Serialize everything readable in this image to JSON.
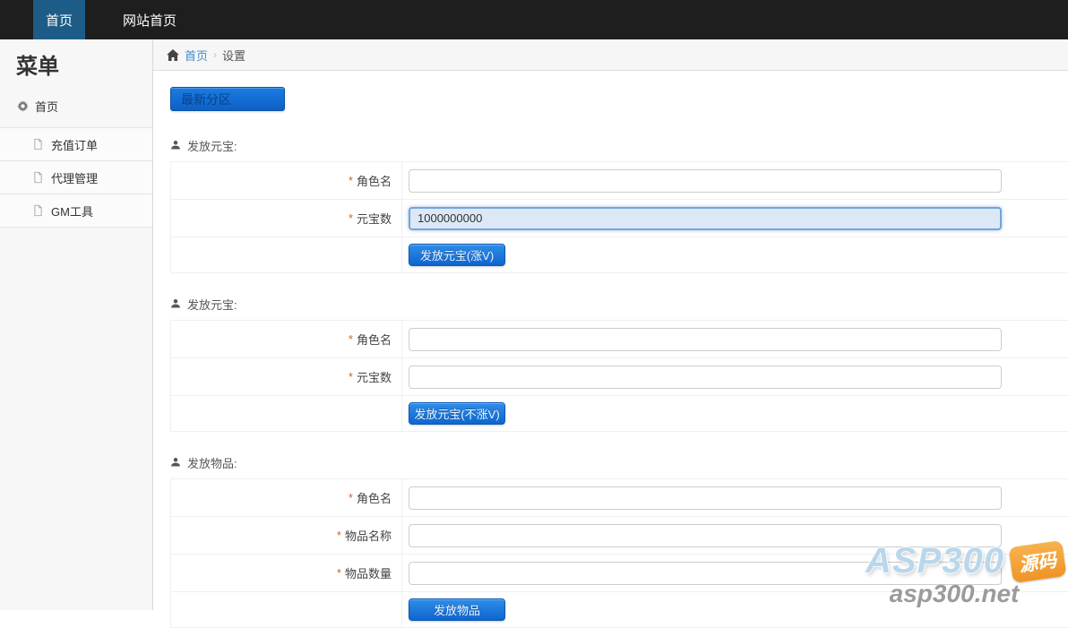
{
  "topbar": {
    "tabs": [
      {
        "label": "首页",
        "active": true
      },
      {
        "label": "网站首页",
        "active": false
      }
    ]
  },
  "sidebar": {
    "title": "菜单",
    "home": {
      "label": "首页"
    },
    "items": [
      {
        "label": "充值订单"
      },
      {
        "label": "代理管理"
      },
      {
        "label": "GM工具"
      }
    ]
  },
  "breadcrumb": {
    "home_label": "首页",
    "separator": "›",
    "current": "设置"
  },
  "content": {
    "zone_button": {
      "label": "最新分区"
    },
    "required_marker": "*",
    "sections": [
      {
        "title": "发放元宝:",
        "fields": [
          {
            "label": "角色名",
            "required": true,
            "value": "",
            "focused": false
          },
          {
            "label": "元宝数",
            "required": true,
            "value": "1000000000",
            "focused": true
          }
        ],
        "submit_label": "发放元宝(涨V)"
      },
      {
        "title": "发放元宝:",
        "fields": [
          {
            "label": "角色名",
            "required": true,
            "value": "",
            "focused": false
          },
          {
            "label": "元宝数",
            "required": true,
            "value": "",
            "focused": false
          }
        ],
        "submit_label": "发放元宝(不涨V)"
      },
      {
        "title": "发放物品:",
        "fields": [
          {
            "label": "角色名",
            "required": true,
            "value": "",
            "focused": false
          },
          {
            "label": "物品名称",
            "required": true,
            "value": "",
            "focused": false
          },
          {
            "label": "物品数量",
            "required": true,
            "value": "",
            "focused": false
          }
        ],
        "submit_label": "发放物品"
      }
    ]
  },
  "watermark": {
    "brand": "ASP300",
    "badge": "源码",
    "site": "asp300.net"
  },
  "colors": {
    "topbar_bg": "#1e1e1e",
    "active_tab_blue": "#1d5c87",
    "primary_button_blue": "#0e65cf",
    "link_blue": "#428bca",
    "focused_input_border": "#74a4d8",
    "focused_input_bg": "#dce8f6",
    "required_marker_orange": "#c9652e",
    "watermark_badge_orange": "#ef9426"
  }
}
